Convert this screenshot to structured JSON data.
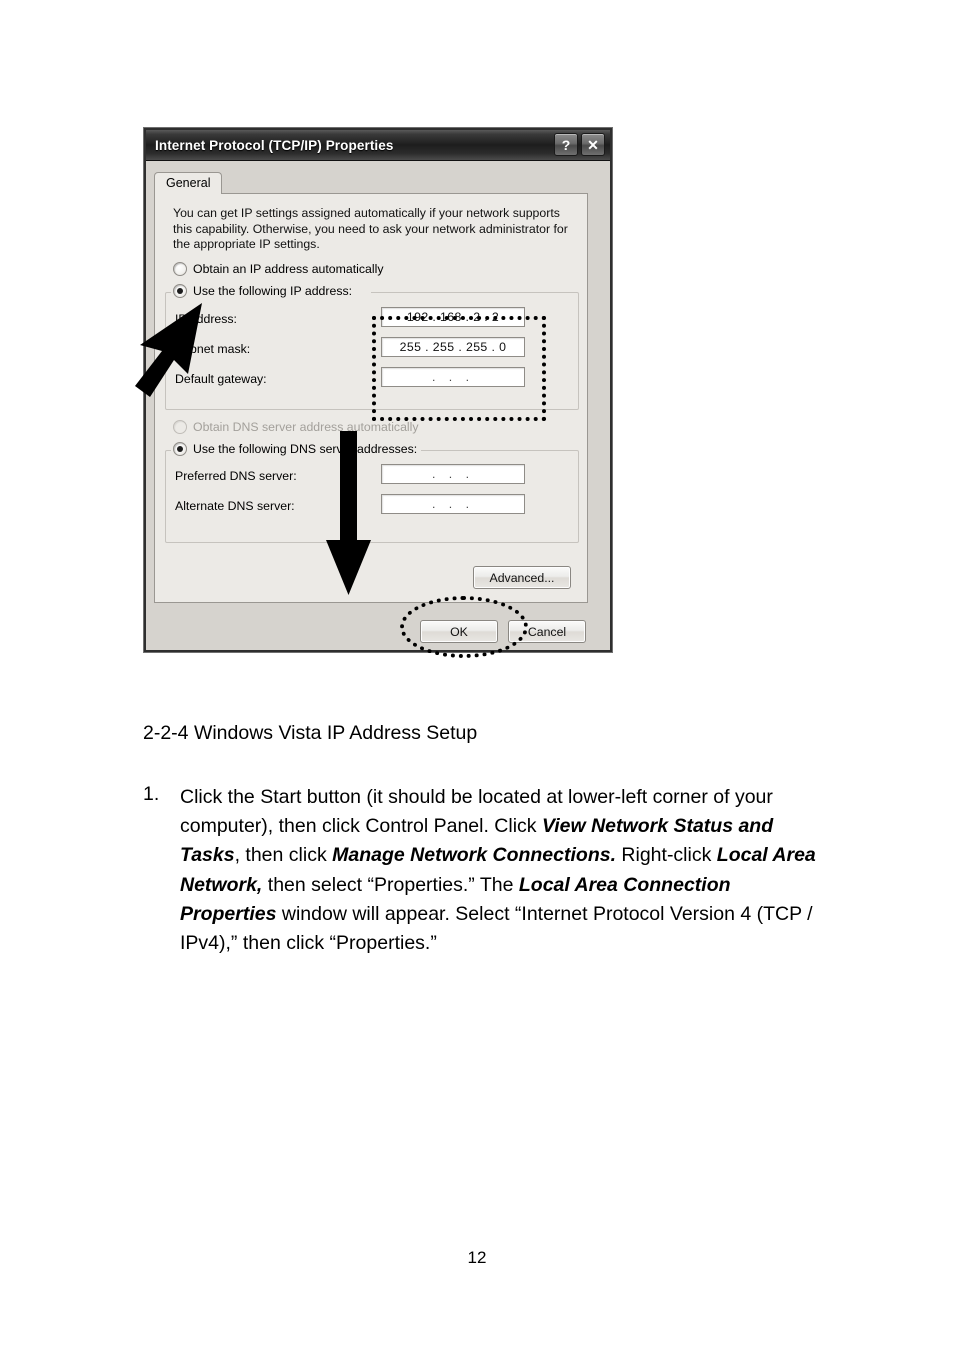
{
  "dialog": {
    "title": "Internet Protocol (TCP/IP) Properties",
    "titlebar_buttons": [
      {
        "name": "help-button",
        "glyph": "?"
      },
      {
        "name": "close-button",
        "glyph": "✕"
      }
    ],
    "tab": "General",
    "intro": "You can get IP settings assigned automatically if your network supports this capability. Otherwise, you need to ask your network administrator for the appropriate IP settings.",
    "ip_section": {
      "radio_auto": "Obtain an IP address automatically",
      "radio_manual": "Use the following IP address:",
      "selected": "manual",
      "fields": [
        {
          "label": "IP address:",
          "value": "192 . 168 .  2  .  2"
        },
        {
          "label": "Subnet mask:",
          "value": "255 . 255 . 255 .  0"
        },
        {
          "label": "Default gateway:",
          "value": " .    .    . "
        }
      ]
    },
    "dns_section": {
      "radio_auto": "Obtain DNS server address automatically",
      "radio_manual": "Use the following DNS server addresses:",
      "selected": "manual",
      "auto_disabled": true,
      "fields": [
        {
          "label": "Preferred DNS server:",
          "value": " .    .    . "
        },
        {
          "label": "Alternate DNS server:",
          "value": " .    .    . "
        }
      ]
    },
    "advanced_button": "Advanced...",
    "ok_button": "OK",
    "cancel_button": "Cancel"
  },
  "annotations": {
    "arrow_cursor": "black-arrow-pointer-at-use-following-ip-radio",
    "down_arrow": "black-down-arrow-to-ok-button",
    "highlight_rect": "dotted-rectangle-around-ip-fields",
    "highlight_ellipse": "dotted-ellipse-around-ok-button"
  },
  "document": {
    "heading": "2-2-4 Windows Vista IP Address Setup",
    "list_number": "1.",
    "paragraph_runs": [
      {
        "text": "Click the Start button (it should be located at lower-left corner of your computer), then click Control Panel. Click ",
        "bold": false
      },
      {
        "text": "View Network Status and Tasks",
        "bold": true
      },
      {
        "text": ", then click ",
        "bold": false
      },
      {
        "text": "Manage Network Connections.",
        "bold": true
      },
      {
        "text": " Right-click ",
        "bold": false
      },
      {
        "text": "Local Area Network,",
        "bold": true
      },
      {
        "text": " then select “Properties.” The ",
        "bold": false
      },
      {
        "text": "Local Area Connection Properties",
        "bold": true
      },
      {
        "text": " window will appear. Select “Internet Protocol Version 4 (TCP / IPv4),” then click “Properties.”",
        "bold": false
      }
    ],
    "page_number": "12"
  }
}
